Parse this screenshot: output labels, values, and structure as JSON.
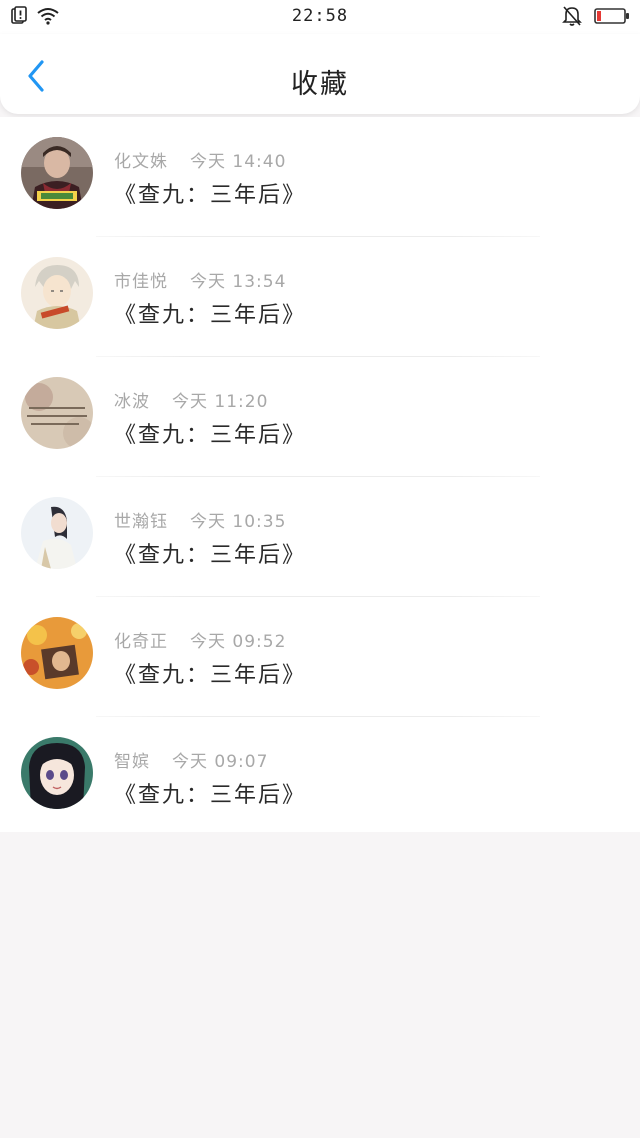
{
  "status_bar": {
    "time": "22:58",
    "icons": [
      "sim-alert-icon",
      "wifi-icon",
      "bell-mute-icon",
      "battery-low-icon"
    ]
  },
  "header": {
    "title": "收藏",
    "back_icon": "chevron-left-icon"
  },
  "colors": {
    "accent": "#2196f3",
    "battery_low": "#e53935",
    "meta_text": "#a8a8a8"
  },
  "favorites": [
    {
      "author": "化文姝",
      "day": "今天",
      "time": "14:40",
      "title": "《查九：三年后》"
    },
    {
      "author": "市佳悦",
      "day": "今天",
      "time": "13:54",
      "title": "《查九：三年后》"
    },
    {
      "author": "冰波",
      "day": "今天",
      "time": "11:20",
      "title": "《查九：三年后》"
    },
    {
      "author": "世瀚钰",
      "day": "今天",
      "time": "10:35",
      "title": "《查九：三年后》"
    },
    {
      "author": "化奇正",
      "day": "今天",
      "time": "09:52",
      "title": "《查九：三年后》"
    },
    {
      "author": "智嫔",
      "day": "今天",
      "time": "09:07",
      "title": "《查九：三年后》"
    }
  ]
}
